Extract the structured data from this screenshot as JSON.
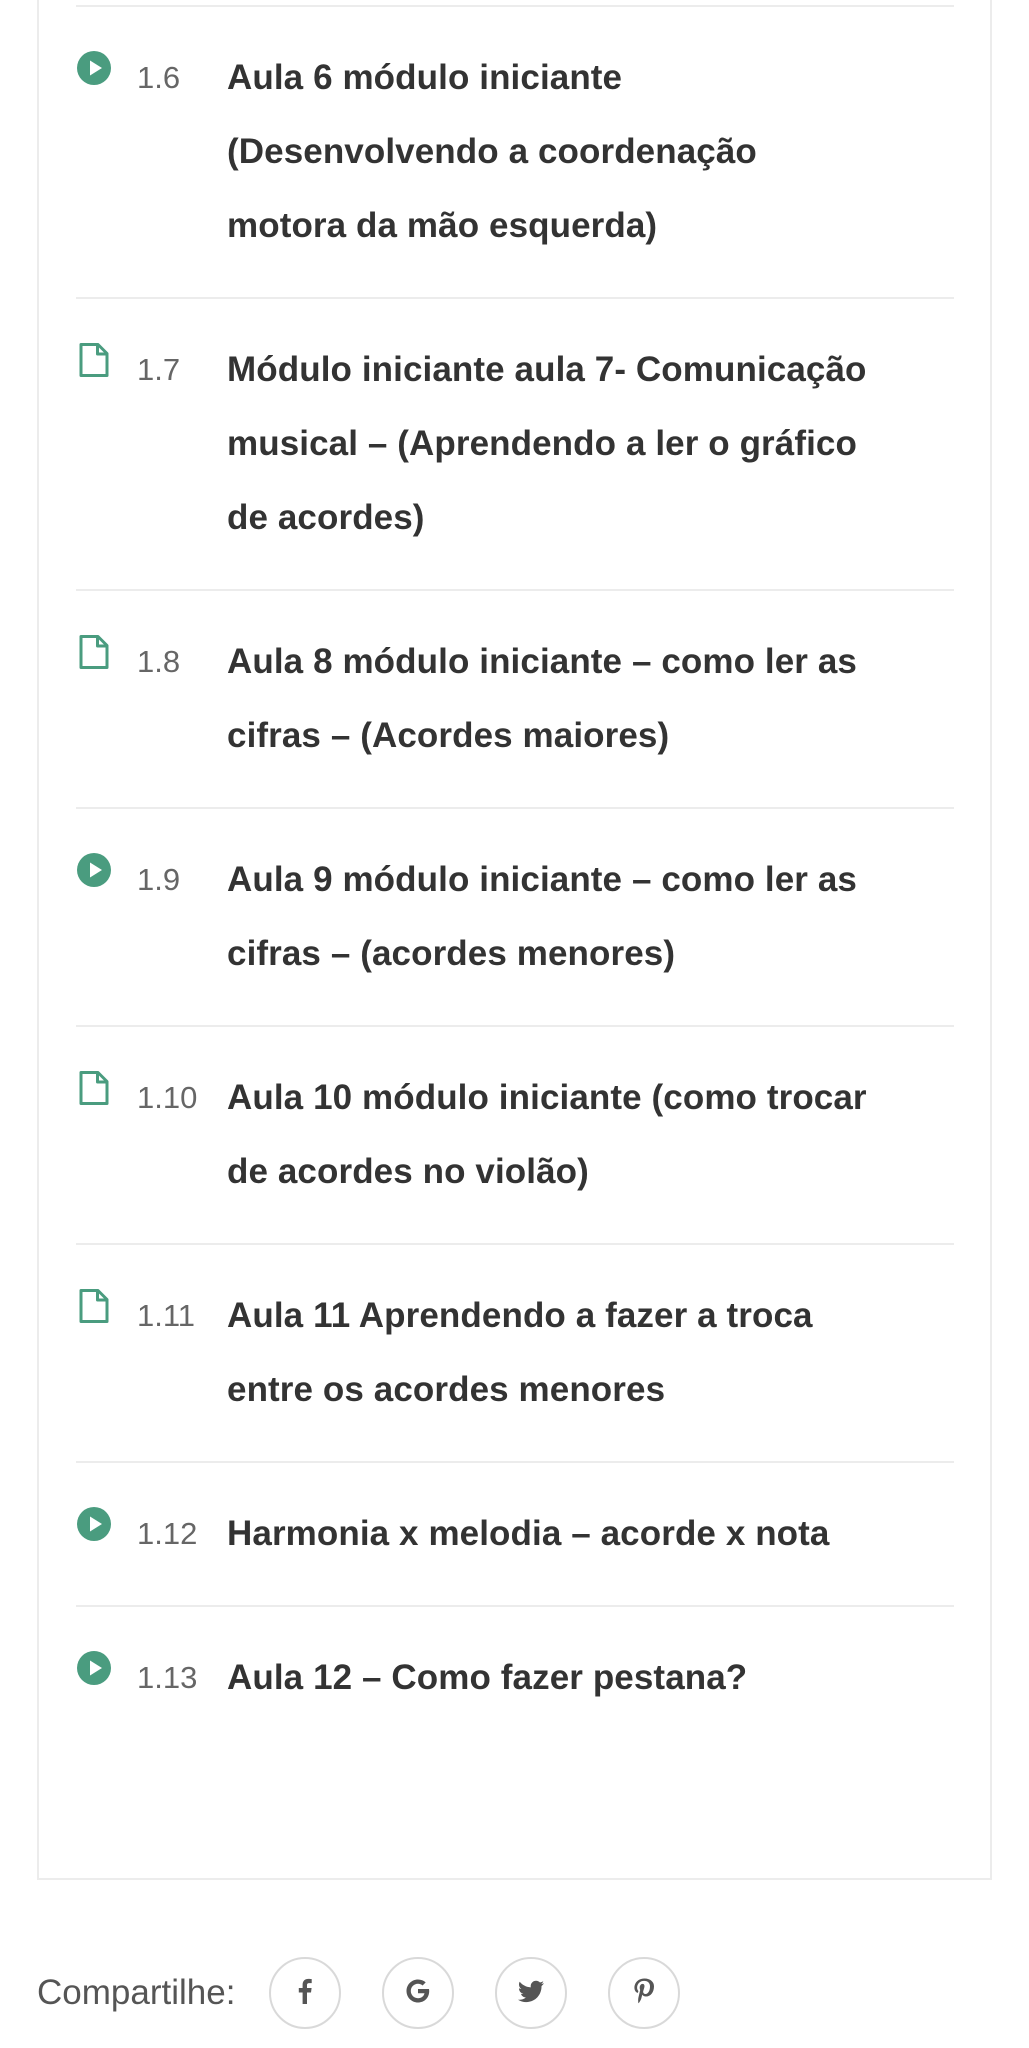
{
  "colors": {
    "accent": "#4a9c7f",
    "text": "#333333",
    "muted": "#666666",
    "divider": "#ececec"
  },
  "lessons": [
    {
      "number": "1.6",
      "icon": "play-circle-icon",
      "title": "Aula 6 módulo iniciante (Desenvolvendo a coordenação motora da mão esquerda)"
    },
    {
      "number": "1.7",
      "icon": "document-icon",
      "title": "Módulo iniciante aula 7- Comunicação musical – (Aprendendo a ler o gráfico de acordes)"
    },
    {
      "number": "1.8",
      "icon": "document-icon",
      "title": "Aula 8 módulo iniciante – como ler as cifras – (Acordes maiores)"
    },
    {
      "number": "1.9",
      "icon": "play-circle-icon",
      "title": "Aula 9 módulo iniciante – como ler as cifras – (acordes menores)"
    },
    {
      "number": "1.10",
      "icon": "document-icon",
      "title": "Aula 10 módulo iniciante (como trocar de acordes no violão)"
    },
    {
      "number": "1.11",
      "icon": "document-icon",
      "title": "Aula 11 Aprendendo a fazer a troca entre os acordes menores"
    },
    {
      "number": "1.12",
      "icon": "play-circle-icon",
      "title": "Harmonia x melodia – acorde x nota"
    },
    {
      "number": "1.13",
      "icon": "play-circle-icon",
      "title": "Aula 12 – Como fazer pestana?"
    }
  ],
  "share": {
    "label": "Compartilhe:",
    "buttons": [
      {
        "icon": "facebook-icon"
      },
      {
        "icon": "google-icon"
      },
      {
        "icon": "twitter-icon"
      },
      {
        "icon": "pinterest-icon"
      }
    ]
  }
}
